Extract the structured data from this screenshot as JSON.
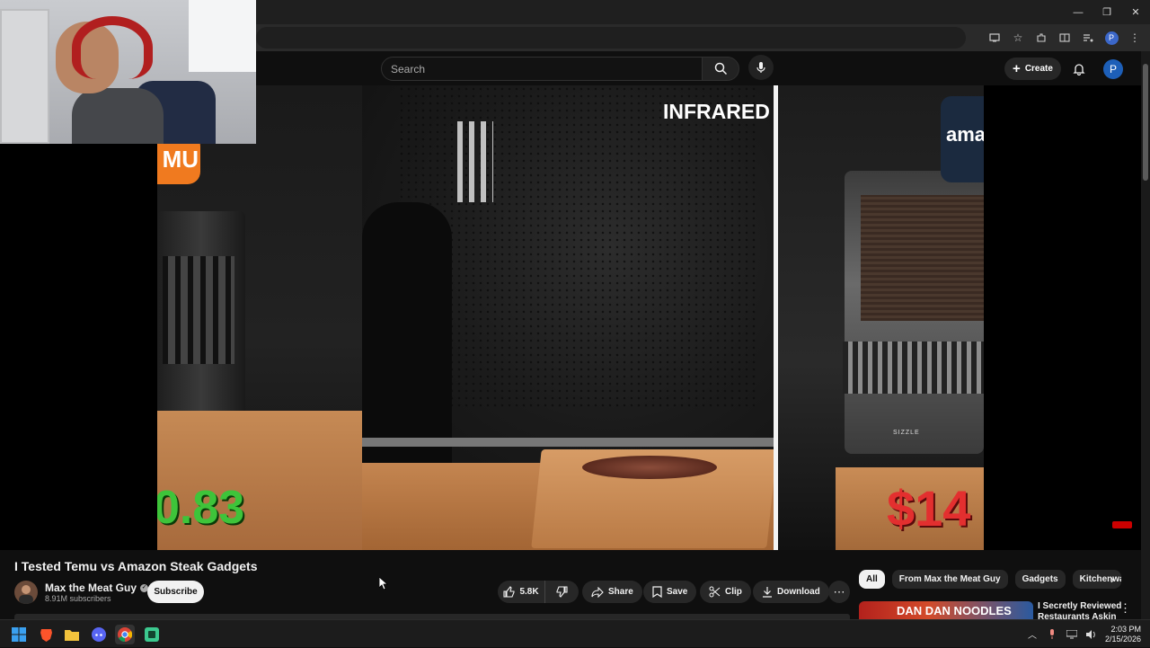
{
  "window_controls": {
    "minimize": "—",
    "restore": "❐",
    "close": "✕"
  },
  "masthead": {
    "search_placeholder": "Search",
    "create_label": "Create",
    "profile_initial": "P"
  },
  "browser": {
    "profile_initial": "P"
  },
  "video_overlays": {
    "badge_left": "MU",
    "badge_right": "ama",
    "heading": "INFRARED",
    "price_left": "0.83",
    "price_right": "$14",
    "oven_brand": "SIZZLE"
  },
  "video": {
    "title": "I Tested Temu vs Amazon Steak Gadgets",
    "channel": "Max the Meat Guy",
    "subscribers": "8.91M subscribers",
    "subscribe_label": "Subscribe"
  },
  "actions": {
    "likes": "5.8K",
    "share": "Share",
    "save": "Save",
    "clip": "Clip",
    "download": "Download"
  },
  "chips": [
    "All",
    "From Max the Meat Guy",
    "Gadgets",
    "Kitchenwa"
  ],
  "recommendation": {
    "thumb_text": "DAN DAN NOODLES",
    "title": "I Secretly Reviewed Restaurants Askin"
  },
  "taskbar": {
    "time": "2:03 PM",
    "date": "2/15/2026"
  },
  "colors": {
    "accent": "#3ea6ff",
    "background": "#0f0f0f",
    "price_green": "#3ec43a",
    "price_red": "#e32f2f"
  }
}
